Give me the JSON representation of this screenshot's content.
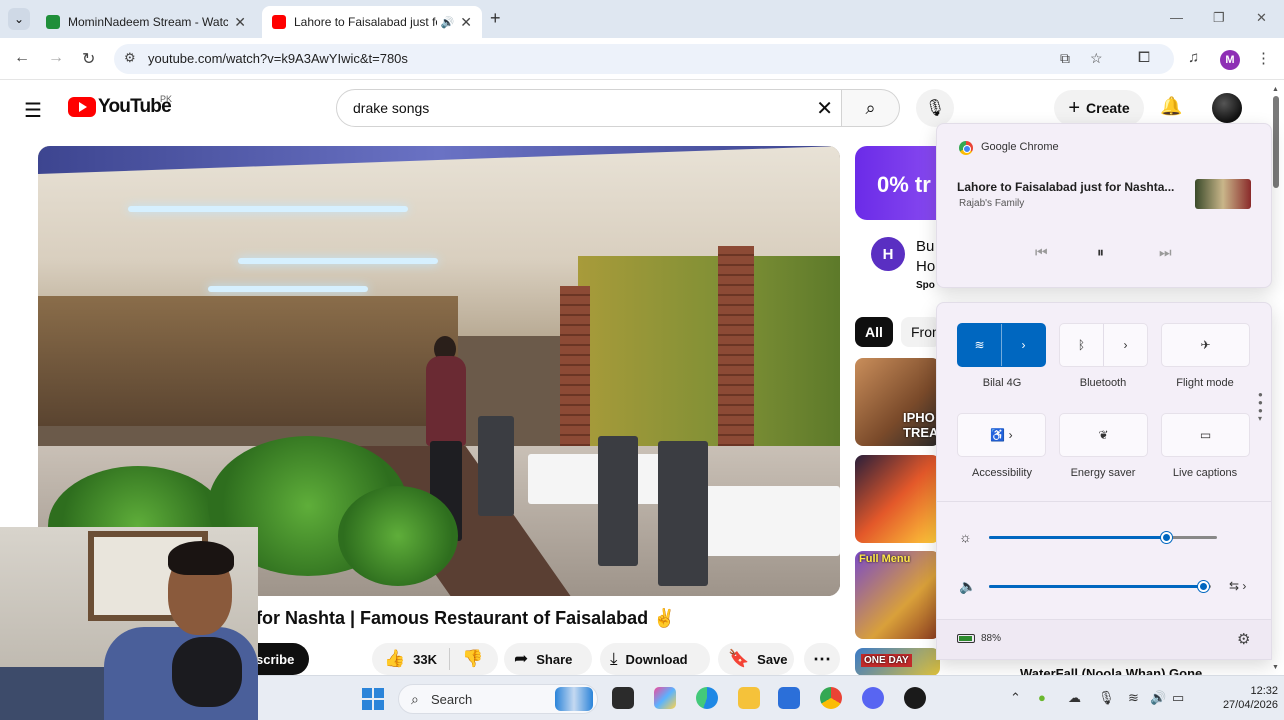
{
  "browser": {
    "tabs": [
      {
        "title": "MominNadeem Stream - Watch",
        "favicon_color": "#1f8f3a"
      },
      {
        "title": "Lahore to Faisalabad just fo",
        "favicon_color": "#ff0000"
      }
    ],
    "url": "youtube.com/watch?v=k9A3AwYIwic&t=780s",
    "profile_initial": "M"
  },
  "youtube": {
    "logo_text": "YouTube",
    "country": "PK",
    "search_query": "drake songs",
    "create_label": "Create",
    "video_title": "for Nashta | Famous Restaurant of Faisalabad ✌",
    "subscribe_label": "scribe",
    "like_count": "33K",
    "share_label": "Share",
    "download_label": "Download",
    "save_label": "Save",
    "ad": {
      "banner_text": "0% tr",
      "logo_letter": "H",
      "line1": "Bu",
      "line2": "Ho",
      "sponsored": "Spo"
    },
    "chips": [
      "All",
      "From"
    ],
    "recommendations": [
      {
        "tag": "IPHO TREA"
      },
      {
        "tag": ""
      },
      {
        "tag": "Full Menu"
      },
      {
        "tag": "ONE DAY"
      }
    ],
    "rec_title_partial": "WaterFall (Noola Whan) Gone"
  },
  "media_flyout": {
    "app": "Google Chrome",
    "title": "Lahore to Faisalabad just for Nashta...",
    "artist": "Rajab's Family"
  },
  "quick_settings": {
    "tiles": [
      {
        "label": "Bilal 4G",
        "icon": "wifi-icon",
        "active": true
      },
      {
        "label": "Bluetooth",
        "icon": "bluetooth-icon",
        "active": false
      },
      {
        "label": "Flight mode",
        "icon": "airplane-icon",
        "active": false
      },
      {
        "label": "Accessibility",
        "icon": "accessibility-icon",
        "active": false
      },
      {
        "label": "Energy saver",
        "icon": "leaf-icon",
        "active": false
      },
      {
        "label": "Live captions",
        "icon": "captions-icon",
        "active": false
      }
    ],
    "brightness": 0.78,
    "volume": 0.97,
    "battery": "88%"
  },
  "taskbar": {
    "search_placeholder": "Search",
    "time": "12:32",
    "date": "27/04/2026",
    "accent": "#0067c0"
  }
}
